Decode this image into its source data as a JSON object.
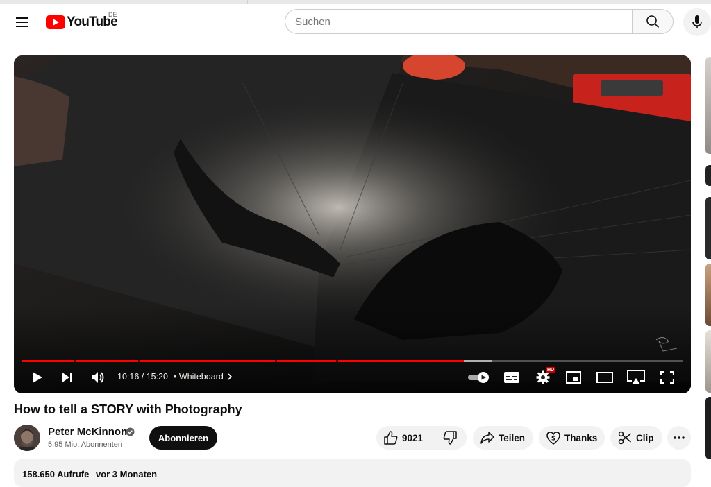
{
  "masthead": {
    "logo_text": "YouTube",
    "region": "DE",
    "search_placeholder": "Suchen",
    "icons": [
      "menu-icon",
      "search-icon",
      "mic-icon"
    ]
  },
  "player": {
    "current_time": "10:16",
    "duration": "15:20",
    "time_display": "10:16 / 15:20",
    "chapter": "Whiteboard",
    "played_fraction": 0.669,
    "loaded_fraction": 0.711,
    "hd_badge": "HD",
    "controls": [
      "play-icon",
      "next-icon",
      "volume-icon",
      "autoplay-toggle",
      "subtitles-icon",
      "settings-icon",
      "miniplayer-icon",
      "theater-icon",
      "airplay-icon",
      "fullscreen-icon"
    ]
  },
  "video": {
    "title": "How to tell a STORY with Photography"
  },
  "channel": {
    "name": "Peter McKinnon",
    "subscribers": "5,95 Mio. Abonnenten",
    "subscribe_label": "Abonnieren"
  },
  "actions": {
    "like_count": "9021",
    "share_label": "Teilen",
    "thanks_label": "Thanks",
    "clip_label": "Clip"
  },
  "description": {
    "views": "158.650 Aufrufe",
    "date": "vor 3 Monaten"
  },
  "colors": {
    "brand_red": "#ff0000",
    "subscribe_bg": "#0f0f0f",
    "pill_bg": "#f2f2f2"
  }
}
